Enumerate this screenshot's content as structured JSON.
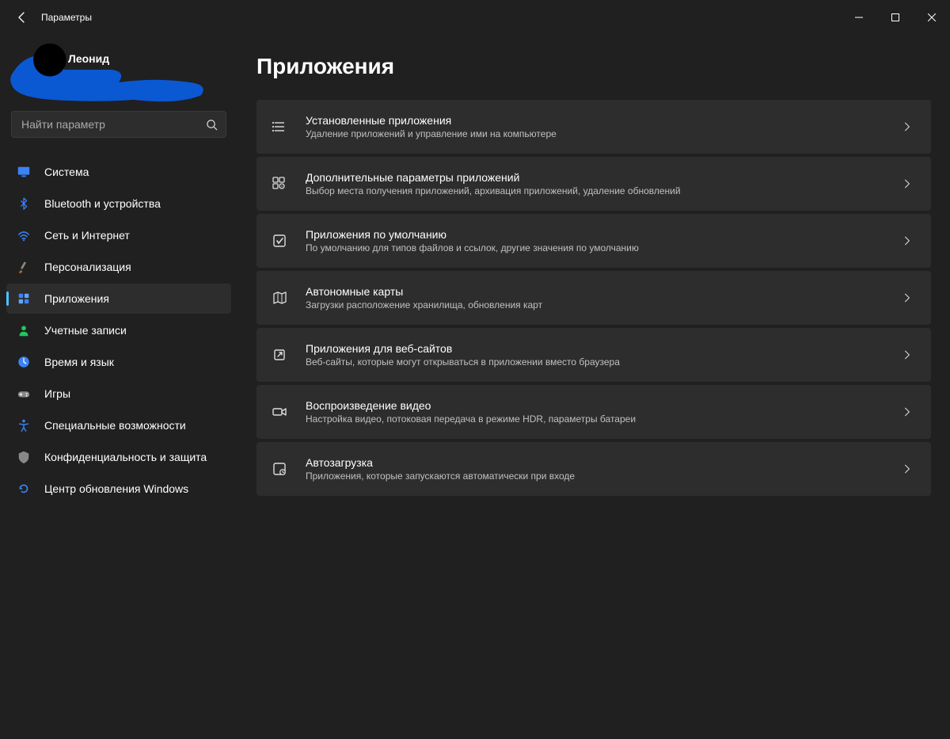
{
  "window": {
    "title": "Параметры"
  },
  "user": {
    "name": "Леонид"
  },
  "search": {
    "placeholder": "Найти параметр"
  },
  "nav": {
    "items": [
      {
        "id": "system",
        "icon": "monitor",
        "label": "Система"
      },
      {
        "id": "bluetooth",
        "icon": "bluetooth",
        "label": "Bluetooth и устройства"
      },
      {
        "id": "network",
        "icon": "wifi",
        "label": "Сеть и Интернет"
      },
      {
        "id": "personalization",
        "icon": "brush",
        "label": "Персонализация"
      },
      {
        "id": "apps",
        "icon": "grid",
        "label": "Приложения",
        "selected": true
      },
      {
        "id": "accounts",
        "icon": "person",
        "label": "Учетные записи"
      },
      {
        "id": "time",
        "icon": "clock",
        "label": "Время и язык"
      },
      {
        "id": "gaming",
        "icon": "gamepad",
        "label": "Игры"
      },
      {
        "id": "accessibility",
        "icon": "accessibility",
        "label": "Специальные возможности"
      },
      {
        "id": "privacy",
        "icon": "shield",
        "label": "Конфиденциальность и защита"
      },
      {
        "id": "update",
        "icon": "sync",
        "label": "Центр обновления Windows"
      }
    ]
  },
  "page": {
    "title": "Приложения",
    "items": [
      {
        "id": "installed",
        "icon": "list",
        "title": "Установленные приложения",
        "sub": "Удаление приложений и управление ими на компьютере"
      },
      {
        "id": "advanced",
        "icon": "grid-gear",
        "title": "Дополнительные параметры приложений",
        "sub": "Выбор места получения приложений, архивация приложений, удаление обновлений"
      },
      {
        "id": "defaults",
        "icon": "check-square",
        "title": "Приложения по умолчанию",
        "sub": "По умолчанию для типов файлов и ссылок, другие значения по умолчанию"
      },
      {
        "id": "maps",
        "icon": "map",
        "title": "Автономные карты",
        "sub": "Загрузки расположение хранилища, обновления карт"
      },
      {
        "id": "websites",
        "icon": "open",
        "title": "Приложения для веб-сайтов",
        "sub": "Веб-сайты, которые могут открываться в приложении вместо браузера"
      },
      {
        "id": "video",
        "icon": "video",
        "title": "Воспроизведение видео",
        "sub": "Настройка видео, потоковая передача в режиме HDR, параметры батареи"
      },
      {
        "id": "startup",
        "icon": "startup",
        "title": "Автозагрузка",
        "sub": "Приложения, которые запускаются автоматически при входе"
      }
    ]
  }
}
